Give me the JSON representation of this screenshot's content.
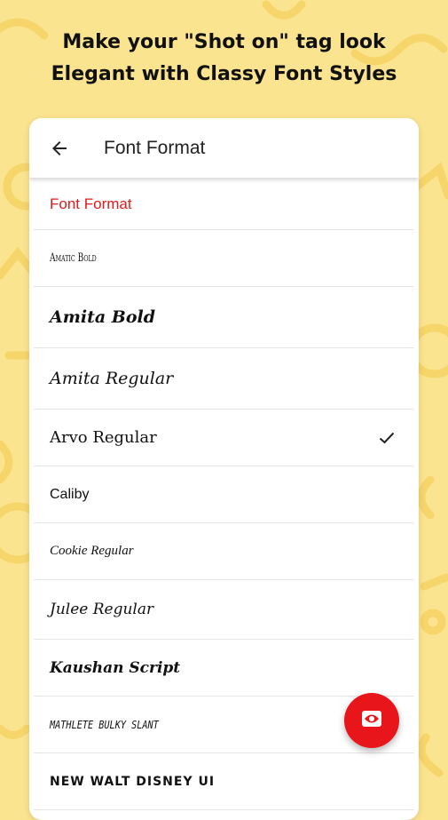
{
  "colors": {
    "background": "#FBE48F",
    "accent": "#E31A1A",
    "fab": "#E8151B"
  },
  "headline": {
    "line1": "Make your \"Shot on\" tag look",
    "line2": "Elegant with Classy Font Styles"
  },
  "appbar": {
    "back_icon": "arrow-left-icon",
    "title": "Font Format"
  },
  "section_header": "Font Format",
  "fonts": [
    {
      "label": "Amatic Bold",
      "selected": false
    },
    {
      "label": "Amita Bold",
      "selected": false
    },
    {
      "label": "Amita Regular",
      "selected": false
    },
    {
      "label": "Arvo Regular",
      "selected": true
    },
    {
      "label": "Caliby",
      "selected": false
    },
    {
      "label": "Cookie Regular",
      "selected": false
    },
    {
      "label": "Julee Regular",
      "selected": false
    },
    {
      "label": "Kaushan Script",
      "selected": false
    },
    {
      "label": "Mathlete Bulky Slant",
      "selected": false
    },
    {
      "label": "New Walt Disney UI",
      "selected": false
    }
  ],
  "fab": {
    "icon": "eye-icon"
  }
}
